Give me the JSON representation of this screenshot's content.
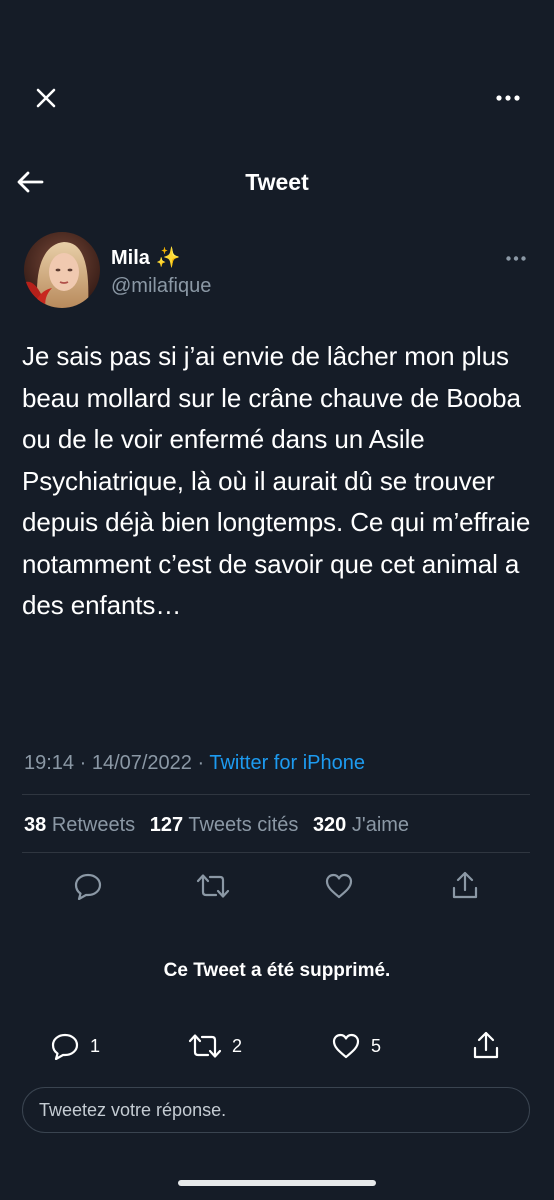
{
  "header": {
    "title": "Tweet"
  },
  "author": {
    "name": "Mila",
    "emoji": "✨",
    "handle": "@milafique"
  },
  "tweet": {
    "text": "Je sais pas si j’ai envie de lâcher mon plus beau mollard sur le crâne chauve de Booba ou de le voir enfermé dans un Asile Psychiatrique, là où il aurait dû se trouver depuis déjà bien longtemps. Ce qui m’effraie notamment c’est de savoir que cet animal a des enfants…",
    "time": "19:14 · 14/07/2022 · ",
    "source": "Twitter for iPhone"
  },
  "stats": {
    "retweets_count": "38",
    "retweets_label": "Retweets",
    "quotes_count": "127",
    "quotes_label": "Tweets cités",
    "likes_count": "320",
    "likes_label": "J'aime"
  },
  "quoted": {
    "deleted_notice": "Ce Tweet a été supprimé.",
    "replies": "1",
    "retweets": "2",
    "likes": "5"
  },
  "reply": {
    "placeholder": "Tweetez votre réponse."
  },
  "colors": {
    "background": "#151c27",
    "accent": "#1d9bf0",
    "muted": "#8b98a5",
    "divider": "#2f3640"
  },
  "icons": [
    "close-icon",
    "more-icon",
    "back-arrow-icon",
    "reply-icon",
    "retweet-icon",
    "like-icon",
    "share-icon"
  ]
}
